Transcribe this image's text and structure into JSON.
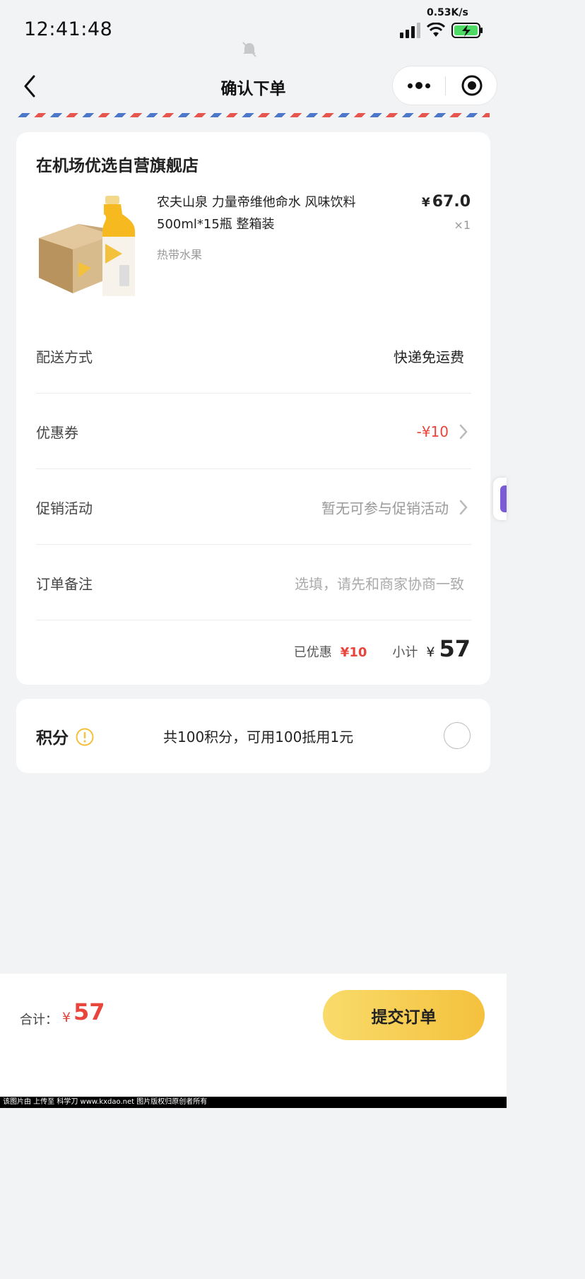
{
  "status_bar": {
    "time": "12:41:48",
    "net_speed": "0.53K/s",
    "icons": [
      "signal-icon",
      "wifi-icon",
      "battery-charging-icon",
      "mute-bell-icon"
    ]
  },
  "nav": {
    "title": "确认下单",
    "icons": [
      "back-chevron-icon",
      "more-dots-icon",
      "close-target-icon"
    ]
  },
  "order": {
    "store_name": "在机场优选自营旗舰店",
    "product": {
      "name": "农夫山泉 力量帝维他命水 风味饮料500ml*15瓶 整箱装",
      "spec": "热带水果",
      "currency": "¥",
      "price": "67.0",
      "qty": "×1"
    },
    "rows": {
      "delivery": {
        "label": "配送方式",
        "value": "快递免运费"
      },
      "coupon": {
        "label": "优惠券",
        "value": "-¥10"
      },
      "promo": {
        "label": "促销活动",
        "value": "暂无可参与促销活动"
      },
      "remark": {
        "label": "订单备注",
        "value": "选填，请先和商家协商一致"
      }
    },
    "summary": {
      "discount_label": "已优惠",
      "discount_value": "¥10",
      "subtotal_label": "小计",
      "currency": "¥",
      "subtotal_value": "57"
    }
  },
  "points": {
    "title": "积分",
    "description": "共100积分，可用100抵用1元"
  },
  "bottom": {
    "total_label": "合计：",
    "currency": "¥",
    "total_value": "57",
    "submit_label": "提交订单"
  },
  "watermark": "该图片由  上传至  科学刀  www.kxdao.net  图片版权归原创者所有",
  "colors": {
    "accent_red": "#e8453c",
    "button_yellow": "#f4c13d",
    "background": "#f2f3f5"
  }
}
